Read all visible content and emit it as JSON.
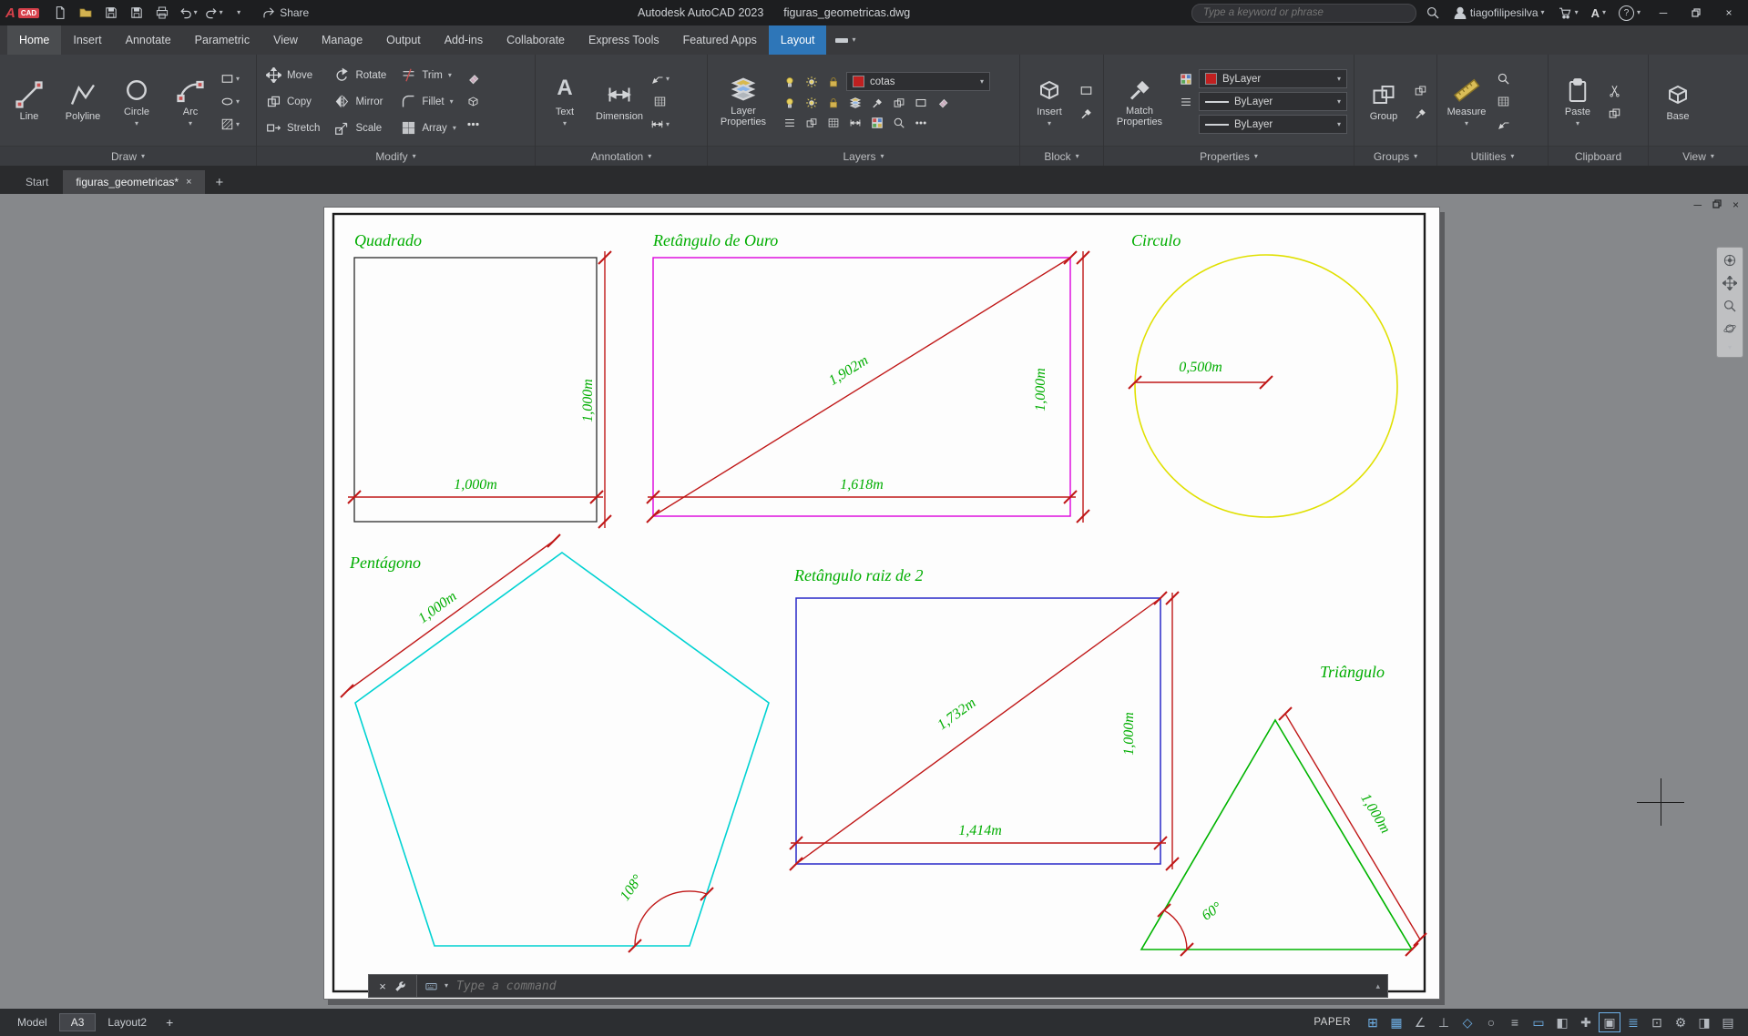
{
  "titlebar": {
    "logo_a": "A",
    "logo_cad": "CAD",
    "share": "Share",
    "app_title": "Autodesk AutoCAD 2023",
    "doc_title": "figuras_geometricas.dwg",
    "search_placeholder": "Type a keyword or phrase",
    "username": "tiagofilipesilva",
    "autodesk_badge": "A",
    "help_badge": "?"
  },
  "ribbon": {
    "tabs": [
      "Home",
      "Insert",
      "Annotate",
      "Parametric",
      "View",
      "Manage",
      "Output",
      "Add-ins",
      "Collaborate",
      "Express Tools",
      "Featured Apps",
      "Layout"
    ],
    "panels": {
      "draw": {
        "label": "Draw",
        "items": [
          "Line",
          "Polyline",
          "Circle",
          "Arc"
        ]
      },
      "modify": {
        "label": "Modify",
        "items": [
          "Move",
          "Rotate",
          "Trim",
          "Copy",
          "Mirror",
          "Fillet",
          "Stretch",
          "Scale",
          "Array"
        ]
      },
      "annotation": {
        "label": "Annotation",
        "text": "Text",
        "dimension": "Dimension"
      },
      "layers": {
        "label": "Layers",
        "big": "Layer Properties",
        "layer_name": "cotas"
      },
      "block": {
        "label": "Block",
        "big": "Insert"
      },
      "properties": {
        "label": "Properties",
        "big": "Match Properties",
        "color": "ByLayer",
        "lineweight": "ByLayer",
        "linetype": "ByLayer"
      },
      "groups": {
        "label": "Groups",
        "big": "Group"
      },
      "utilities": {
        "label": "Utilities",
        "big": "Measure"
      },
      "clipboard": {
        "label": "Clipboard",
        "big": "Paste"
      },
      "view": {
        "label": "View",
        "big": "Base"
      }
    }
  },
  "file_tabs": {
    "start": "Start",
    "active": "figuras_geometricas*",
    "new": "+"
  },
  "figures": {
    "quadrado": {
      "title": "Quadrado",
      "width": "1,000m",
      "height": "1,000m"
    },
    "retangulo_ouro": {
      "title": "Retângulo de Ouro",
      "diagonal": "1,902m",
      "height": "1,000m",
      "width": "1,618m"
    },
    "circulo": {
      "title": "Circulo",
      "radius": "0,500m"
    },
    "pentagono": {
      "title": "Pentágono",
      "side": "1,000m",
      "angle": "108°"
    },
    "retangulo_raiz2": {
      "title": "Retângulo raiz de 2",
      "diagonal": "1,732m",
      "height": "1,000m",
      "width": "1,414m"
    },
    "triangulo": {
      "title": "Triângulo",
      "side": "1,000m",
      "angle": "60°"
    }
  },
  "command_line": {
    "placeholder": "Type a command"
  },
  "status_bar": {
    "model": "Model",
    "layout_a3": "A3",
    "layout2": "Layout2",
    "new_layout": "+",
    "space": "PAPER",
    "icons": [
      {
        "name": "grid",
        "glyph": "⊞"
      },
      {
        "name": "snap-mode",
        "glyph": "▦"
      },
      {
        "name": "infer-constraints",
        "glyph": "∠"
      },
      {
        "name": "ortho",
        "glyph": "⊥"
      },
      {
        "name": "polar-tracking",
        "glyph": "◇"
      },
      {
        "name": "isodraft",
        "glyph": "○"
      },
      {
        "name": "object-snap-tracking",
        "glyph": "≡"
      },
      {
        "name": "object-snap",
        "glyph": "▭"
      },
      {
        "name": "lineweight",
        "glyph": "◧"
      },
      {
        "name": "transparency",
        "glyph": "✚"
      },
      {
        "name": "selection-cycling",
        "glyph": "▣"
      },
      {
        "name": "dynamic-input",
        "glyph": "≣"
      },
      {
        "name": "annotation-visibility",
        "glyph": "⊡"
      },
      {
        "name": "workspace",
        "glyph": "⚙"
      },
      {
        "name": "annotation-monitor",
        "glyph": "◨"
      },
      {
        "name": "clean-screen",
        "glyph": "▤"
      }
    ]
  },
  "colors": {
    "accent_blue": "#2e76b8",
    "dim_red": "#c01818",
    "label_green": "#00ad00",
    "circle_yellow": "#e0e000",
    "pentagon_cyan": "#00d2d2",
    "rect_magenta": "#dd00dd",
    "rect_blue": "#2828c8"
  }
}
